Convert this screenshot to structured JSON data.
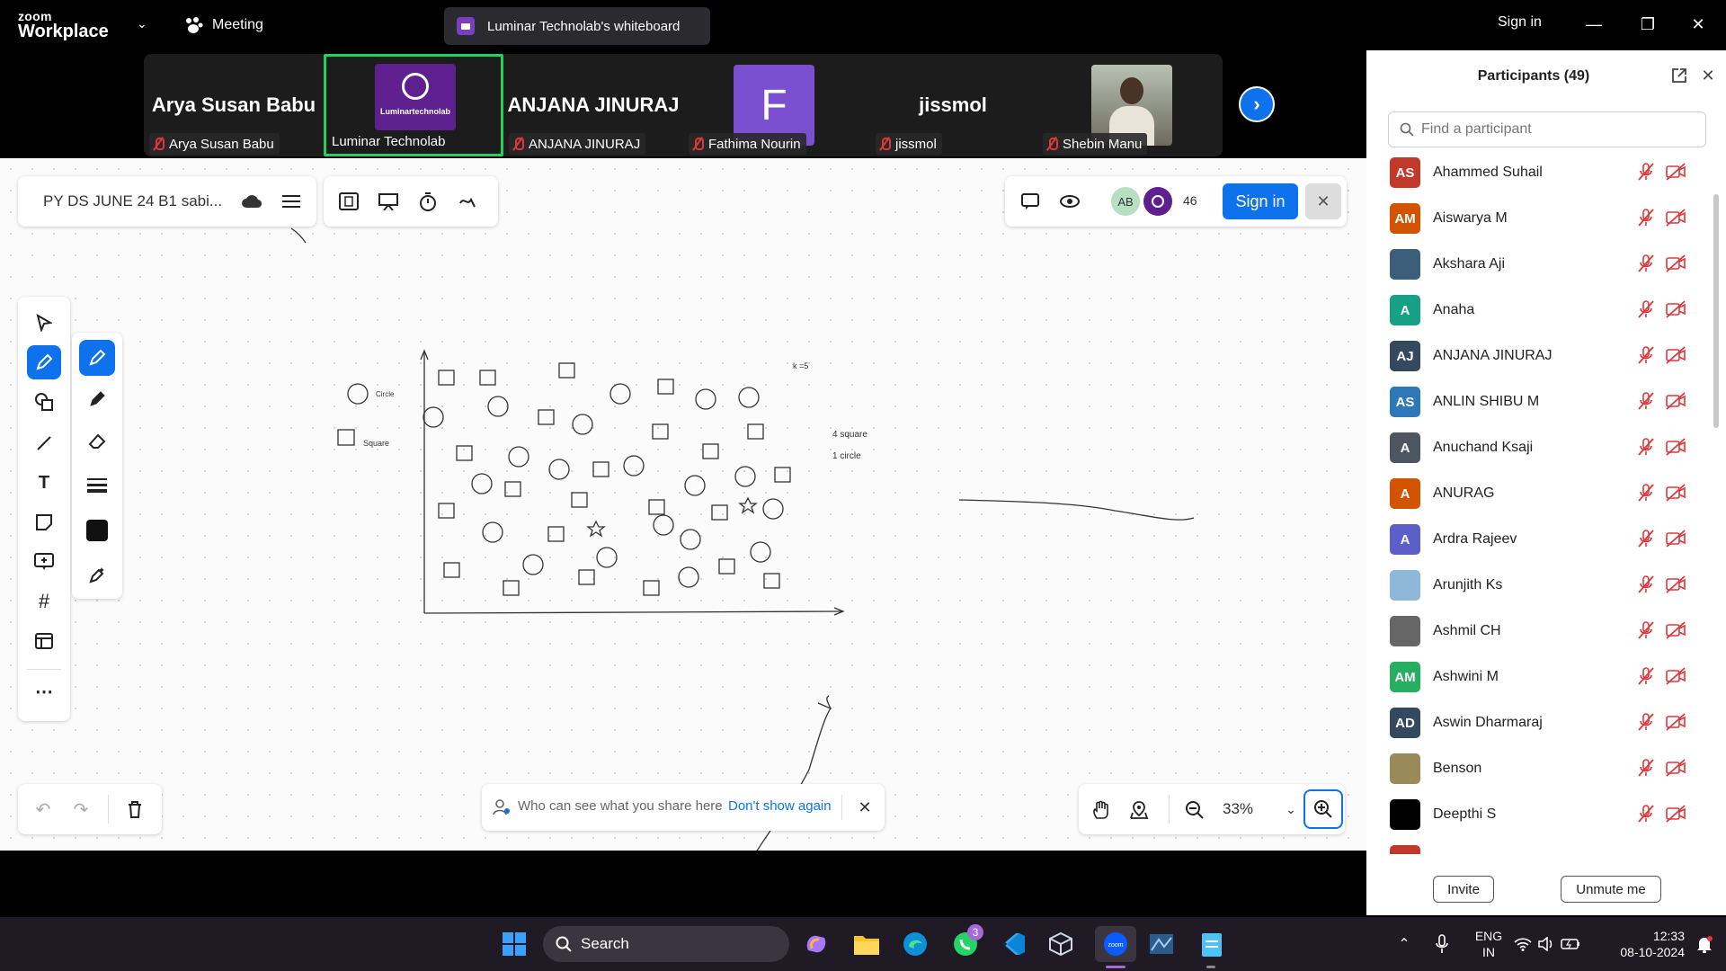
{
  "app": {
    "logo_top": "zoom",
    "logo_bottom": "Workplace",
    "meeting_label": "Meeting",
    "whiteboard_tab": "Luminar Technolab's whiteboard",
    "sign_in": "Sign in"
  },
  "video_strip": {
    "tiles": [
      {
        "big_name": "Arya Susan Babu",
        "caption": "Arya Susan Babu"
      },
      {
        "caption": "Luminar Technolab",
        "logo_text": "Luminartechnolab"
      },
      {
        "big_name": "ANJANA JINURAJ",
        "caption": "ANJANA JINURAJ"
      },
      {
        "initial": "F",
        "caption": "Fathima Nourin"
      },
      {
        "big_name": "jissmol",
        "caption": "jissmol"
      },
      {
        "caption": "Shebin Manu"
      }
    ]
  },
  "whiteboard": {
    "file_name": "PY DS JUNE 24 B1 sabi...",
    "sign_in": "Sign in",
    "avatar_initials": "AB",
    "viewer_count": "46",
    "zoom": "33%",
    "share_notice": "Who can see what you share here",
    "dont_show_again": "Don't show again",
    "canvas_labels": {
      "legend_circle": "Circle",
      "legend_square": "Square",
      "k_label": "k =5",
      "count_square": "4 square",
      "count_circle": "1  circle"
    }
  },
  "participants": {
    "title": "Participants (49)",
    "search_placeholder": "Find a participant",
    "list": [
      {
        "initials": "AS",
        "name": "Ahammed Suhail",
        "color": "#c0392b"
      },
      {
        "initials": "AM",
        "name": "Aiswarya M",
        "color": "#d35400"
      },
      {
        "initials": "",
        "name": "Akshara Aji",
        "color": "#3b5f7a"
      },
      {
        "initials": "A",
        "name": "Anaha",
        "color": "#16a085"
      },
      {
        "initials": "AJ",
        "name": "ANJANA JINURAJ",
        "color": "#34495e"
      },
      {
        "initials": "AS",
        "name": "ANLIN SHIBU M",
        "color": "#2e78b8"
      },
      {
        "initials": "A",
        "name": "Anuchand Ksaji",
        "color": "#4d5560"
      },
      {
        "initials": "A",
        "name": "ANURAG",
        "color": "#d35400"
      },
      {
        "initials": "A",
        "name": "Ardra Rajeev",
        "color": "#5b5fc7"
      },
      {
        "initials": "",
        "name": "Arunjith Ks",
        "color": "#8fb8d8"
      },
      {
        "initials": "",
        "name": "Ashmil CH",
        "color": "#666666"
      },
      {
        "initials": "AM",
        "name": "Ashwini M",
        "color": "#27ae60"
      },
      {
        "initials": "AD",
        "name": "Aswin Dharmaraj",
        "color": "#34495e"
      },
      {
        "initials": "",
        "name": "Benson",
        "color": "#9a8a5a"
      },
      {
        "initials": "",
        "name": "Deepthi S",
        "color": "#000000"
      }
    ],
    "invite": "Invite",
    "unmute_me": "Unmute me"
  },
  "taskbar": {
    "search": "Search",
    "whatsapp_badge": "3",
    "lang_top": "ENG",
    "lang_bottom": "IN",
    "time": "12:33",
    "date": "08-10-2024"
  }
}
